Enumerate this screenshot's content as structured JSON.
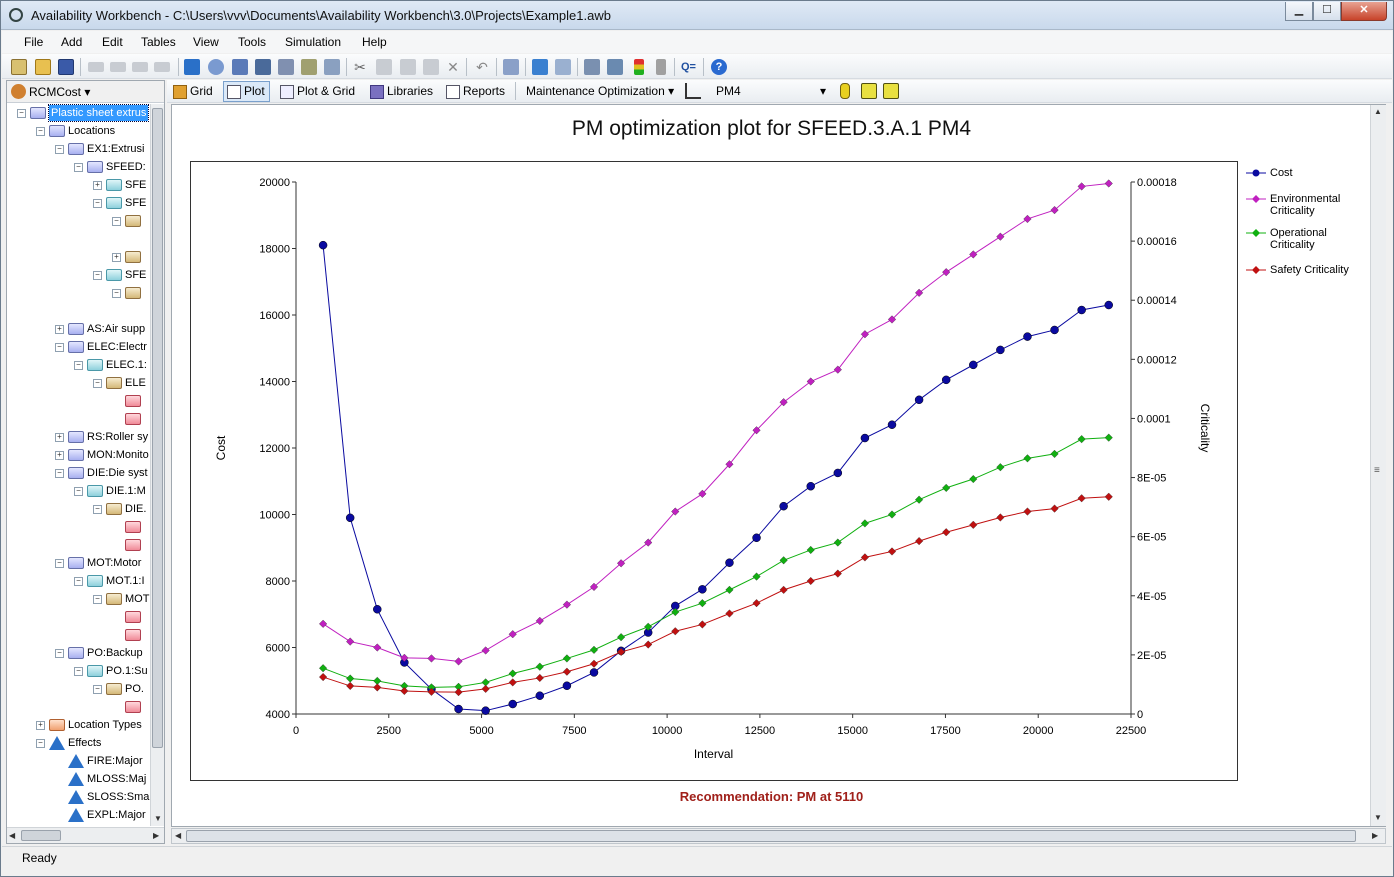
{
  "window": {
    "title": "Availability Workbench - C:\\Users\\vvv\\Documents\\Availability Workbench\\3.0\\Projects\\Example1.awb",
    "min": "▁",
    "max": "☐",
    "close": "✕"
  },
  "menu": [
    "File",
    "Add",
    "Edit",
    "Tables",
    "View",
    "Tools",
    "Simulation",
    "Help"
  ],
  "left_panel": {
    "dropdown": "RCMCost",
    "tree": [
      {
        "label": "Plastic sheet extrus",
        "exp": "-",
        "icon": "folder-icon",
        "sel": true
      },
      {
        "label": "Locations",
        "exp": "-",
        "icon": "folder-icon"
      },
      {
        "label": "EX1:Extrusi",
        "exp": "-",
        "icon": "location-icon"
      },
      {
        "label": "SFEED:",
        "exp": "-",
        "icon": "location-icon"
      },
      {
        "label": "SFE",
        "exp": "+",
        "icon": "equipment-icon"
      },
      {
        "label": "SFE",
        "exp": "-",
        "icon": "equipment-icon"
      },
      {
        "label": "",
        "exp": "-",
        "icon": "function-icon"
      },
      {
        "label": "",
        "exp": "",
        "icon": ""
      },
      {
        "label": "",
        "exp": "+",
        "icon": "function-icon"
      },
      {
        "label": "SFE",
        "exp": "-",
        "icon": "equipment-icon"
      },
      {
        "label": "",
        "exp": "-",
        "icon": "function-icon"
      },
      {
        "label": "",
        "exp": "",
        "icon": ""
      },
      {
        "label": "AS:Air supp",
        "exp": "+",
        "icon": "location-icon"
      },
      {
        "label": "ELEC:Electr",
        "exp": "-",
        "icon": "location-icon"
      },
      {
        "label": "ELEC.1:",
        "exp": "-",
        "icon": "equipment-icon"
      },
      {
        "label": "ELE",
        "exp": "-",
        "icon": "function-icon"
      },
      {
        "label": "",
        "exp": "",
        "icon": "failure-icon"
      },
      {
        "label": "",
        "exp": "",
        "icon": "failure-icon"
      },
      {
        "label": "RS:Roller sy",
        "exp": "+",
        "icon": "location-icon"
      },
      {
        "label": "MON:Monito",
        "exp": "+",
        "icon": "location-icon"
      },
      {
        "label": "DIE:Die syst",
        "exp": "-",
        "icon": "location-icon"
      },
      {
        "label": "DIE.1:M",
        "exp": "-",
        "icon": "equipment-icon"
      },
      {
        "label": "DIE.",
        "exp": "-",
        "icon": "function-icon"
      },
      {
        "label": "",
        "exp": "",
        "icon": "failure-icon"
      },
      {
        "label": "",
        "exp": "",
        "icon": "failure-icon"
      },
      {
        "label": "MOT:Motor",
        "exp": "-",
        "icon": "location-icon"
      },
      {
        "label": "MOT.1:I",
        "exp": "-",
        "icon": "equipment-icon"
      },
      {
        "label": "MOT",
        "exp": "-",
        "icon": "function-icon"
      },
      {
        "label": "",
        "exp": "",
        "icon": "failure-icon"
      },
      {
        "label": "",
        "exp": "",
        "icon": "failure-icon"
      },
      {
        "label": "PO:Backup",
        "exp": "-",
        "icon": "location-icon"
      },
      {
        "label": "PO.1:Su",
        "exp": "-",
        "icon": "equipment-icon"
      },
      {
        "label": "PO.",
        "exp": "-",
        "icon": "function-icon"
      },
      {
        "label": "",
        "exp": "",
        "icon": "failure-icon"
      },
      {
        "label": "Location Types",
        "exp": "+",
        "icon": "types-icon"
      },
      {
        "label": "Effects",
        "exp": "-",
        "icon": "warning-icon"
      },
      {
        "label": "FIRE:Major",
        "exp": "",
        "icon": "warning-icon"
      },
      {
        "label": "MLOSS:Maj",
        "exp": "",
        "icon": "warning-icon"
      },
      {
        "label": "SLOSS:Sma",
        "exp": "",
        "icon": "warning-icon"
      },
      {
        "label": "EXPL:Major",
        "exp": "",
        "icon": "warning-icon"
      }
    ]
  },
  "view_toolbar": {
    "tabs": [
      "Grid",
      "Plot",
      "Plot & Grid",
      "Libraries",
      "Reports"
    ],
    "mode": "Maintenance Optimization",
    "task": "PM4"
  },
  "plot": {
    "title": "PM optimization plot for SFEED.3.A.1 PM4",
    "recommendation": "Recommendation: PM at 5110"
  },
  "chart_data": {
    "type": "line",
    "xlabel": "Interval",
    "ylabel": "Cost",
    "y2label": "Criticality",
    "xlim": [
      0,
      22500
    ],
    "ylim": [
      4000,
      20000
    ],
    "y2lim": [
      0,
      0.00018
    ],
    "xticks": [
      "0",
      "2500",
      "5000",
      "7500",
      "10000",
      "12500",
      "15000",
      "17500",
      "20000",
      "22500"
    ],
    "yticks": [
      "4000",
      "6000",
      "8000",
      "10000",
      "12000",
      "14000",
      "16000",
      "18000",
      "20000"
    ],
    "y2ticks": [
      "0",
      "2E-05",
      "4E-05",
      "6E-05",
      "8E-05",
      "0.0001",
      "0.00012",
      "0.00014",
      "0.00016",
      "0.00018"
    ],
    "x": [
      730,
      1460,
      2190,
      2920,
      3650,
      4380,
      5110,
      5840,
      6570,
      7300,
      8030,
      8760,
      9490,
      10220,
      10950,
      11680,
      12410,
      13140,
      13870,
      14600,
      15330,
      16060,
      16790,
      17520,
      18250,
      18980,
      19710,
      20440,
      21170,
      21900
    ],
    "series": [
      {
        "name": "Cost",
        "axis": "left",
        "color": "#0a0aa0",
        "values": [
          18100,
          9900,
          7150,
          5550,
          4750,
          4150,
          4100,
          4300,
          4550,
          4850,
          5250,
          5900,
          6450,
          7250,
          7750,
          8550,
          9300,
          10250,
          10850,
          11250,
          12300,
          12700,
          13450,
          14050,
          14500,
          14950,
          15350,
          15550,
          16150,
          16300
        ]
      },
      {
        "name": "Environmental Criticality",
        "axis": "right",
        "color": "#c020c0",
        "values": [
          3.05e-05,
          2.45e-05,
          2.25e-05,
          1.9e-05,
          1.88e-05,
          1.78e-05,
          2.15e-05,
          2.7e-05,
          3.15e-05,
          3.7e-05,
          4.3e-05,
          5.1e-05,
          5.8e-05,
          6.85e-05,
          7.45e-05,
          8.45e-05,
          9.6e-05,
          0.0001055,
          0.0001125,
          0.0001165,
          0.0001285,
          0.0001335,
          0.0001425,
          0.0001495,
          0.0001555,
          0.0001615,
          0.0001675,
          0.0001705,
          0.0001785,
          0.0001795
        ]
      },
      {
        "name": "Operational Criticality",
        "axis": "right",
        "color": "#10b010",
        "values": [
          1.55e-05,
          1.2e-05,
          1.12e-05,
          9.5e-06,
          9e-06,
          9.2e-06,
          1.07e-05,
          1.37e-05,
          1.6e-05,
          1.88e-05,
          2.17e-05,
          2.6e-05,
          2.95e-05,
          3.45e-05,
          3.75e-05,
          4.2e-05,
          4.65e-05,
          5.2e-05,
          5.55e-05,
          5.8e-05,
          6.45e-05,
          6.75e-05,
          7.25e-05,
          7.65e-05,
          7.95e-05,
          8.35e-05,
          8.65e-05,
          8.8e-05,
          9.3e-05,
          9.35e-05
        ]
      },
      {
        "name": "Safety Criticality",
        "axis": "right",
        "color": "#c01010",
        "values": [
          1.25e-05,
          9.5e-06,
          9e-06,
          7.8e-06,
          7.5e-06,
          7.4e-06,
          8.5e-06,
          1.07e-05,
          1.22e-05,
          1.43e-05,
          1.7e-05,
          2.1e-05,
          2.35e-05,
          2.8e-05,
          3.03e-05,
          3.4e-05,
          3.75e-05,
          4.2e-05,
          4.5e-05,
          4.75e-05,
          5.3e-05,
          5.5e-05,
          5.85e-05,
          6.15e-05,
          6.4e-05,
          6.65e-05,
          6.85e-05,
          6.95e-05,
          7.3e-05,
          7.35e-05
        ]
      }
    ]
  }
}
